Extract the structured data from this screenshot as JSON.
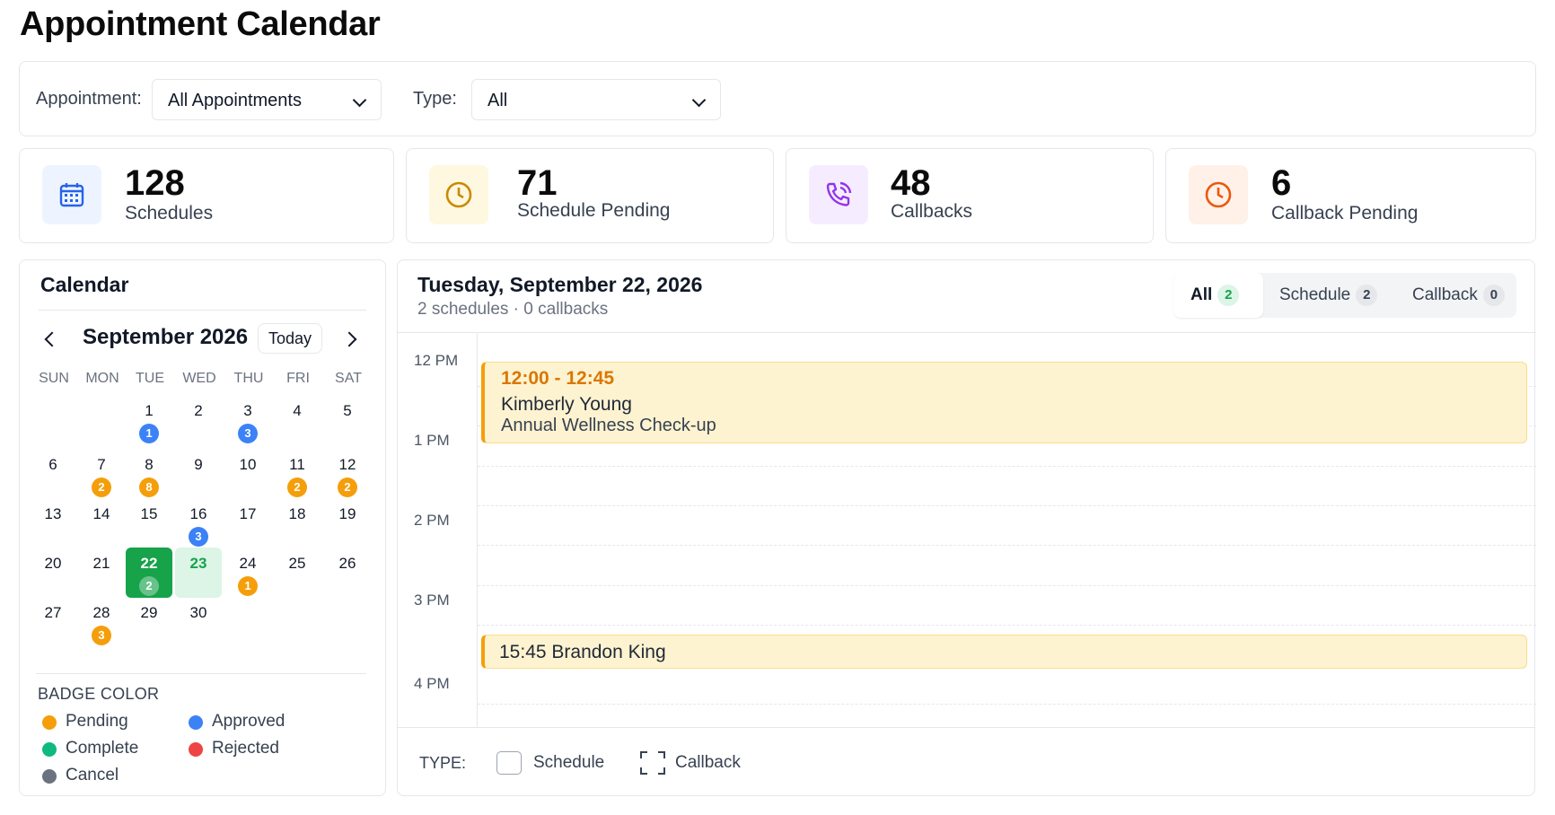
{
  "page": {
    "title": "Appointment Calendar"
  },
  "filters": {
    "appointment_label": "Appointment:",
    "appointment_value": "All Appointments",
    "type_label": "Type:",
    "type_value": "All"
  },
  "stats": [
    {
      "value": "128",
      "label": "Schedules",
      "icon": "calendar-icon",
      "color": "#2563eb",
      "bg": "#eef4ff"
    },
    {
      "value": "71",
      "label": "Schedule Pending",
      "icon": "clock-icon",
      "color": "#ca8a04",
      "bg": "#fef8e1"
    },
    {
      "value": "48",
      "label": "Callbacks",
      "icon": "phone-callback-icon",
      "color": "#9333ea",
      "bg": "#f5edff"
    },
    {
      "value": "6",
      "label": "Callback Pending",
      "icon": "clock-icon",
      "color": "#ea580c",
      "bg": "#fff1e8"
    }
  ],
  "calendar": {
    "title": "Calendar",
    "month_label": "September 2026",
    "today_label": "Today",
    "weekdays": [
      "SUN",
      "MON",
      "TUE",
      "WED",
      "THU",
      "FRI",
      "SAT"
    ],
    "days": [
      {
        "d": "1",
        "badge": "1",
        "status": "approved"
      },
      {
        "d": "2"
      },
      {
        "d": "3",
        "badge": "3",
        "status": "approved"
      },
      {
        "d": "4"
      },
      {
        "d": "5"
      },
      {
        "d": "6"
      },
      {
        "d": "7",
        "badge": "2",
        "status": "pending"
      },
      {
        "d": "8",
        "badge": "8",
        "status": "pending"
      },
      {
        "d": "9"
      },
      {
        "d": "10"
      },
      {
        "d": "11",
        "badge": "2",
        "status": "pending"
      },
      {
        "d": "12",
        "badge": "2",
        "status": "pending"
      },
      {
        "d": "13"
      },
      {
        "d": "14"
      },
      {
        "d": "15"
      },
      {
        "d": "16",
        "badge": "3",
        "status": "approved"
      },
      {
        "d": "17"
      },
      {
        "d": "18"
      },
      {
        "d": "19"
      },
      {
        "d": "20"
      },
      {
        "d": "21"
      },
      {
        "d": "22",
        "badge": "2",
        "status": "selected",
        "state": "selected"
      },
      {
        "d": "23",
        "state": "today"
      },
      {
        "d": "24",
        "badge": "1",
        "status": "pending"
      },
      {
        "d": "25"
      },
      {
        "d": "26"
      },
      {
        "d": "27"
      },
      {
        "d": "28",
        "badge": "3",
        "status": "pending"
      },
      {
        "d": "29"
      },
      {
        "d": "30"
      }
    ],
    "legend_title": "BADGE COLOR",
    "legend": [
      {
        "label": "Pending",
        "color": "#f59e0b"
      },
      {
        "label": "Approved",
        "color": "#3b82f6"
      },
      {
        "label": "Complete",
        "color": "#10b981"
      },
      {
        "label": "Rejected",
        "color": "#ef4444"
      },
      {
        "label": "Cancel",
        "color": "#6b7280"
      }
    ]
  },
  "day_view": {
    "title": "Tuesday, September 22, 2026",
    "subtitle": "2 schedules · 0 callbacks",
    "tabs": [
      {
        "label": "All",
        "count": "2",
        "active": true
      },
      {
        "label": "Schedule",
        "count": "2"
      },
      {
        "label": "Callback",
        "count": "0"
      }
    ],
    "time_labels": [
      "12 PM",
      "1 PM",
      "2 PM",
      "3 PM",
      "4 PM"
    ],
    "events": [
      {
        "time": "12:00 - 12:45",
        "name": "Kimberly Young",
        "desc": "Annual Wellness Check-up"
      },
      {
        "title": "15:45 Brandon King"
      }
    ],
    "type_label": "TYPE:",
    "type_schedule": "Schedule",
    "type_callback": "Callback"
  }
}
